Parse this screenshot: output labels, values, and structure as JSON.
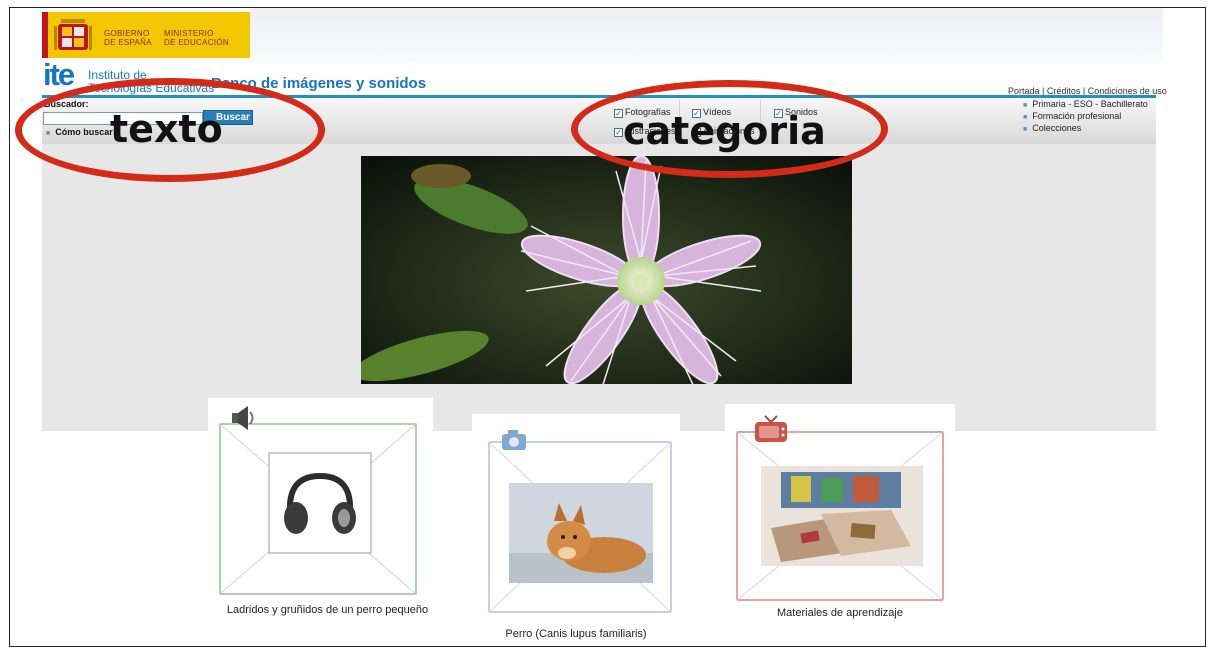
{
  "header": {
    "gov_line1": "GOBIERNO",
    "gov_line2": "DE ESPAÑA",
    "ministry_line1": "MINISTERIO",
    "ministry_line2": "DE EDUCACIÓN",
    "ite_logo": "ite",
    "ite_sub1": "Instituto de",
    "ite_sub2": "Tecnologías Educativas",
    "bank_title": "Banco de imágenes y sonidos",
    "top_links": "Portada | Créditos | Condiciones de uso"
  },
  "search": {
    "label": "Buscador:",
    "input_value": "",
    "button_label": "Buscar",
    "help_link": "Cómo buscar"
  },
  "categories": [
    {
      "label": "Fotografías",
      "checked": true
    },
    {
      "label": "Vídeos",
      "checked": true
    },
    {
      "label": "Sonidos",
      "checked": true
    },
    {
      "label": "Ilustraciones",
      "checked": true
    },
    {
      "label": "Animaciones",
      "checked": true
    }
  ],
  "right_menu": [
    "Primaria - ESO - Bachillerato",
    "Formación profesional",
    "Colecciones"
  ],
  "annotations": {
    "texto": "texto",
    "categoria": "categoria",
    "color": "#d42a18"
  },
  "cards": [
    {
      "icon": "speaker-icon",
      "caption": "Ladridos y gruñidos de un perro pequeño",
      "frame_color": "#5aa65a"
    },
    {
      "icon": "camera-icon",
      "caption": "Perro (Canis lupus familiaris)",
      "frame_color": "#8f9fc6"
    },
    {
      "icon": "tv-icon",
      "caption": "Materiales de aprendizaje",
      "frame_color": "#c24a42"
    }
  ]
}
